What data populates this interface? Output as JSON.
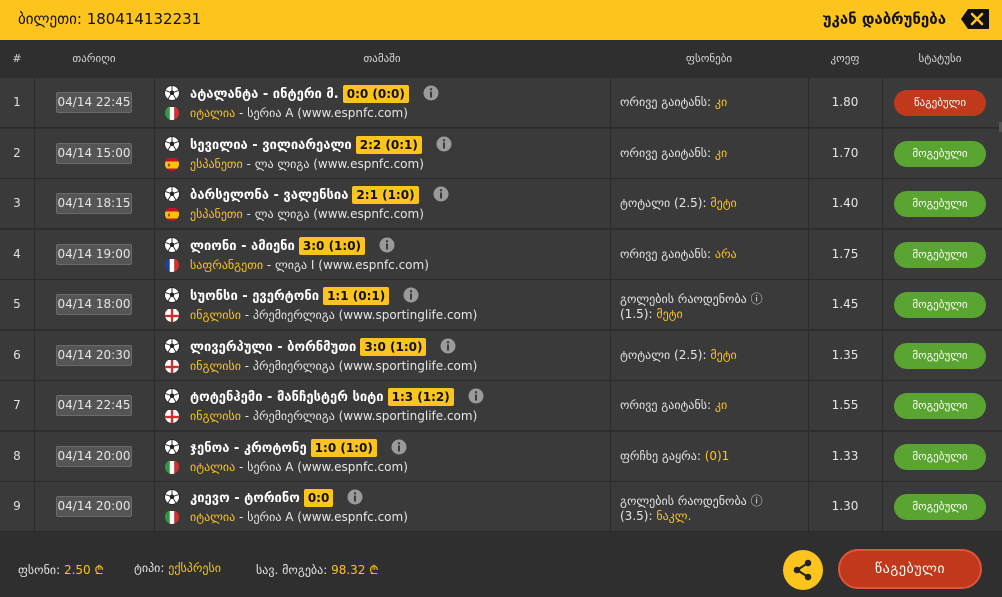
{
  "header": {
    "ticket_label": "ბილეთი: 180414132231",
    "back_label": "უკან დაბრუნება",
    "back_icon": "close-x-icon"
  },
  "columns": {
    "num": "#",
    "date": "თარიღი",
    "match": "თამაში",
    "bet": "ფსონები",
    "odd": "კოეფ",
    "status": "სტატუსი"
  },
  "rows": [
    {
      "num": "1",
      "date": "04/14 22:45",
      "match": "ატალანტა - ინტერი მ.",
      "score": "0:0 (0:0)",
      "country": "იტალია",
      "league": " - სერია A (www.espnfc.com)",
      "flag": "italy-flag-icon",
      "bet_lines": [
        "ორივე გაიტანს: ",
        ""
      ],
      "bet_sel": "კი",
      "odd": "1.80",
      "status": "წაგებული",
      "status_type": "lost"
    },
    {
      "num": "2",
      "date": "04/14 15:00",
      "match": "სევილია - ვილიარეალი",
      "score": "2:2 (0:1)",
      "country": "ესპანეთი",
      "league": " - ლა ლიგა (www.espnfc.com)",
      "flag": "spain-flag-icon",
      "bet_lines": [
        "ორივე გაიტანს: ",
        ""
      ],
      "bet_sel": "კი",
      "odd": "1.70",
      "status": "მოგებული",
      "status_type": "won"
    },
    {
      "num": "3",
      "date": "04/14 18:15",
      "match": "ბარსელონა - ვალენსია",
      "score": "2:1 (1:0)",
      "country": "ესპანეთი",
      "league": " - ლა ლიგა (www.espnfc.com)",
      "flag": "spain-flag-icon",
      "bet_lines": [
        "ტოტალი (2.5): ",
        ""
      ],
      "bet_sel": "მეტი",
      "odd": "1.40",
      "status": "მოგებული",
      "status_type": "won"
    },
    {
      "num": "4",
      "date": "04/14 19:00",
      "match": "ლიონი - ამიენი",
      "score": "3:0 (1:0)",
      "country": "საფრანგეთი",
      "league": " - ლიგა I (www.espnfc.com)",
      "flag": "france-flag-icon",
      "bet_lines": [
        "ორივე გაიტანს: ",
        ""
      ],
      "bet_sel": "არა",
      "odd": "1.75",
      "status": "მოგებული",
      "status_type": "won"
    },
    {
      "num": "5",
      "date": "04/14 18:00",
      "match": "სუონსი - ევერტონი",
      "score": "1:1 (0:1)",
      "country": "ინგლისი",
      "league": " - პრემიერლიგა (www.sportinglife.com)",
      "flag": "england-flag-icon",
      "bet_lines": [
        "გოლების რაოდენობა ⓘ",
        "(1.5): "
      ],
      "bet_sel": "მეტი",
      "odd": "1.45",
      "status": "მოგებული",
      "status_type": "won"
    },
    {
      "num": "6",
      "date": "04/14 20:30",
      "match": "ლივერპული - ბორნმუთი",
      "score": "3:0 (1:0)",
      "country": "ინგლისი",
      "league": " - პრემიერლიგა (www.sportinglife.com)",
      "flag": "england-flag-icon",
      "bet_lines": [
        "ტოტალი (2.5): ",
        ""
      ],
      "bet_sel": "მეტი",
      "odd": "1.35",
      "status": "მოგებული",
      "status_type": "won"
    },
    {
      "num": "7",
      "date": "04/14 22:45",
      "match": "ტოტენჰემი - მანჩესტერ სიტი",
      "score": "1:3 (1:2)",
      "country": "ინგლისი",
      "league": " - პრემიერლიგა (www.sportinglife.com)",
      "flag": "england-flag-icon",
      "bet_lines": [
        "ორივე გაიტანს: ",
        ""
      ],
      "bet_sel": "კი",
      "odd": "1.55",
      "status": "მოგებული",
      "status_type": "won"
    },
    {
      "num": "8",
      "date": "04/14 20:00",
      "match": "ჯენოა - კროტონე",
      "score": "1:0 (1:0)",
      "country": "იტალია",
      "league": " - სერია A (www.espnfc.com)",
      "flag": "italy-flag-icon",
      "bet_lines": [
        "ფრჩხე გაყრა: ",
        ""
      ],
      "bet_sel": "(0)1",
      "odd": "1.33",
      "status": "მოგებული",
      "status_type": "won"
    },
    {
      "num": "9",
      "date": "04/14 20:00",
      "match": "კიევო - ტორინო",
      "score": "0:0",
      "country": "იტალია",
      "league": " - სერია A (www.espnfc.com)",
      "flag": "italy-flag-icon",
      "bet_lines": [
        "გოლების რაოდენობა ⓘ",
        "(3.5): "
      ],
      "bet_sel": "ნაკლ.",
      "odd": "1.30",
      "status": "მოგებული",
      "status_type": "won"
    }
  ],
  "footer": {
    "stake_label": "ფსონი: ",
    "stake_value": "2.50 ₾",
    "type_label": "ტიპი: ",
    "type_value": "ექსპრესი",
    "payout_label": "სავ. მოგება: ",
    "payout_value": "98.32 ₾",
    "share_icon": "share-icon",
    "result_label": "წაგებული"
  },
  "colors": {
    "accent": "#fcc41c",
    "lost": "#c0391b",
    "won": "#5aa532",
    "row_bg": "#3a3a3a",
    "page_bg": "#2f2f2f"
  }
}
